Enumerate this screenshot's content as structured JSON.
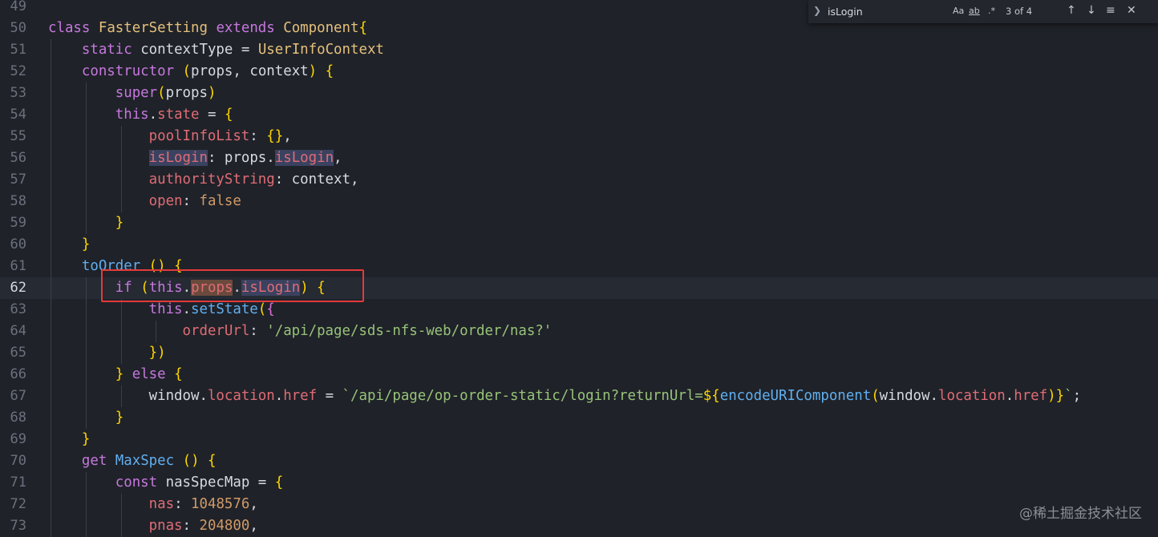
{
  "find_widget": {
    "toggle_icon": "chevron-right-icon",
    "query": "isLogin",
    "match_case_label": "Aa",
    "whole_word_label": "ab",
    "regex_label": ".*",
    "result_count": "3 of 4",
    "prev_icon": "arrow-up-icon",
    "next_icon": "arrow-down-icon",
    "selection_icon": "find-in-selection-icon",
    "close_icon": "close-icon"
  },
  "editor": {
    "current_line": 62,
    "lines": [
      {
        "n": "49"
      },
      {
        "n": "50",
        "code": "class FasterSetting extends Component{"
      },
      {
        "n": "51",
        "code": "    static contextType = UserInfoContext"
      },
      {
        "n": "52",
        "code": "    constructor (props, context) {"
      },
      {
        "n": "53",
        "code": "        super(props)"
      },
      {
        "n": "54",
        "code": "        this.state = {"
      },
      {
        "n": "55",
        "code": "            poolInfoList: {},"
      },
      {
        "n": "56",
        "code": "            isLogin: props.isLogin,"
      },
      {
        "n": "57",
        "code": "            authorityString: context,"
      },
      {
        "n": "58",
        "code": "            open: false"
      },
      {
        "n": "59",
        "code": "        }"
      },
      {
        "n": "60",
        "code": "    }"
      },
      {
        "n": "61",
        "code": "    toOrder () {"
      },
      {
        "n": "62",
        "code": "        if (this.props.isLogin) {"
      },
      {
        "n": "63",
        "code": "            this.setState({"
      },
      {
        "n": "64",
        "code": "                orderUrl: '/api/page/sds-nfs-web/order/nas?'"
      },
      {
        "n": "65",
        "code": "            })"
      },
      {
        "n": "66",
        "code": "        } else {"
      },
      {
        "n": "67",
        "code": "            window.location.href = `/api/page/op-order-static/login?returnUrl=${encodeURIComponent(window.location.href)}`;"
      },
      {
        "n": "68",
        "code": "        }"
      },
      {
        "n": "69",
        "code": "    }"
      },
      {
        "n": "70",
        "code": "    get MaxSpec () {"
      },
      {
        "n": "71",
        "code": "        const nasSpecMap = {"
      },
      {
        "n": "72",
        "code": "            nas: 1048576,"
      },
      {
        "n": "73",
        "code": "            pnas: 204800,"
      }
    ]
  },
  "watermark": "@稀土掘金技术社区",
  "colors": {
    "background": "#1f2229",
    "keyword": "#c678dd",
    "class_name": "#e5c07b",
    "function": "#61afef",
    "property": "#e06c75",
    "string": "#98c379",
    "number": "#d19a66",
    "annotation_box": "#e53a3a"
  }
}
